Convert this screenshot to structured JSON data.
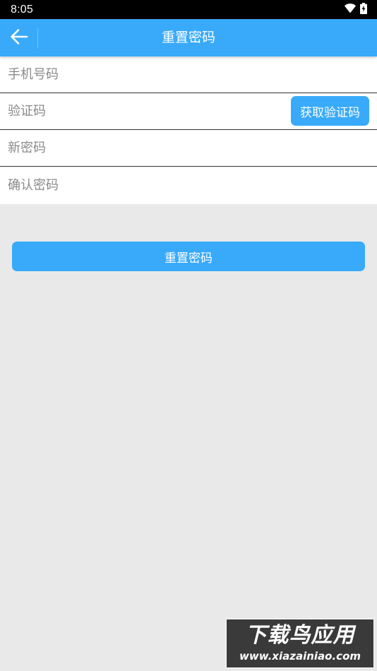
{
  "status_bar": {
    "time": "8:05",
    "icons": [
      "wifi-icon",
      "battery-charging-icon"
    ]
  },
  "app_bar": {
    "title": "重置密码",
    "back_icon": "arrow-left-icon",
    "color": "#39aaf9"
  },
  "form": {
    "phone_placeholder": "手机号码",
    "code_placeholder": "验证码",
    "get_code_label": "获取验证码",
    "new_password_placeholder": "新密码",
    "confirm_password_placeholder": "确认密码"
  },
  "submit_label": "重置密码",
  "watermark": {
    "title": "下载鸟应用",
    "url": "www.xiazainiao.com"
  },
  "colors": {
    "accent": "#39aaf9",
    "background": "#e9e9e9",
    "divider": "#333333"
  }
}
